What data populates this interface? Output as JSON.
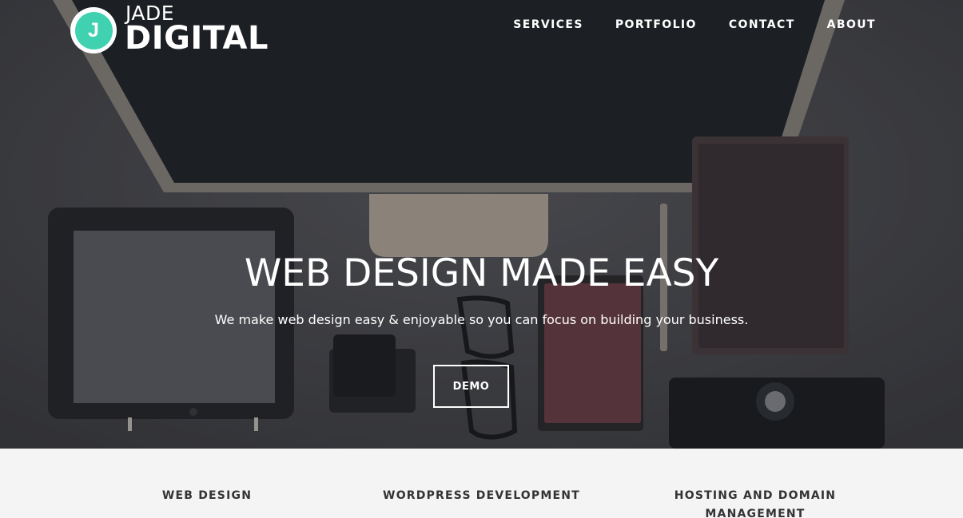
{
  "brand": {
    "badge_letter": "J",
    "name_top": "JADE",
    "name_bottom": "DIGITAL",
    "accent_color": "#3fd1b0"
  },
  "nav": {
    "items": [
      "SERVICES",
      "PORTFOLIO",
      "CONTACT",
      "ABOUT"
    ]
  },
  "hero": {
    "title": "WEB DESIGN MADE EASY",
    "subtitle": "We make web design easy & enjoyable so you can focus on building your business.",
    "cta_label": "DEMO"
  },
  "services": {
    "items": [
      "WEB DESIGN",
      "WORDPRESS DEVELOPMENT",
      "HOSTING AND DOMAIN MANAGEMENT"
    ]
  }
}
